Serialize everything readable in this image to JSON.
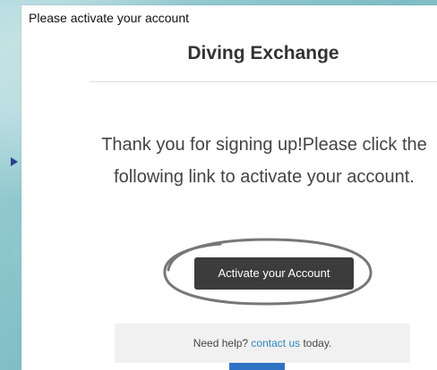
{
  "email": {
    "subject": "Please activate your account",
    "brand": "Diving Exchange",
    "message": "Thank you for signing up!Please click the following link to activate your account.",
    "activate_button_label": "Activate your Account",
    "help_prefix": "Need help? ",
    "help_link_label": "contact us",
    "help_suffix": " today."
  },
  "colors": {
    "button_background": "#3c3c3c",
    "link": "#2e86c1",
    "help_background": "#f1f1f1",
    "partial_button": "#2f72c4"
  }
}
